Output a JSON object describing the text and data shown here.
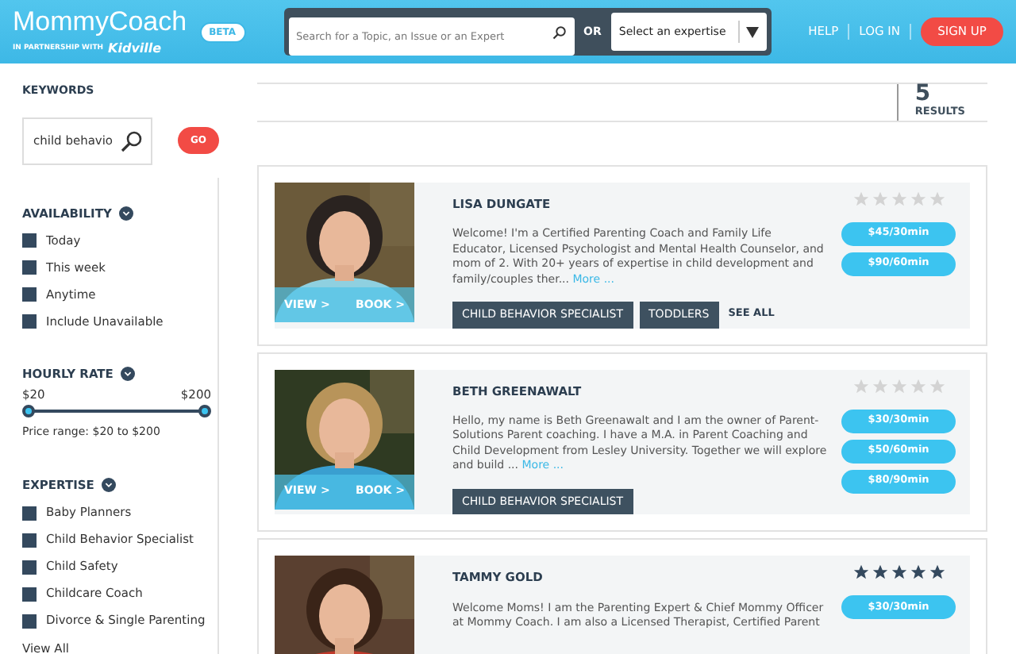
{
  "header": {
    "logo": "MommyCoach",
    "partner_prefix": "IN PARTNERSHIP WITH",
    "partner": "Kidville",
    "badge": "BETA",
    "search": {
      "placeholder": "Search for a Topic, an Issue or an Expert"
    },
    "or": "OR",
    "expertise_select": "Select an expertise",
    "links": [
      "HELP",
      "LOG IN"
    ],
    "signup": "SIGN UP"
  },
  "sidebar": {
    "keywords_label": "KEYWORDS",
    "keyword": "child behavio",
    "go": "GO",
    "availability": {
      "title": "AVAILABILITY",
      "items": [
        {
          "label": "Today",
          "checked": false
        },
        {
          "label": "This week",
          "checked": false
        },
        {
          "label": "Anytime",
          "checked": false
        },
        {
          "label": "Include Unavailable",
          "checked": false
        }
      ]
    },
    "rate": {
      "title": "HOURLY RATE",
      "min": "$20",
      "max": "$200",
      "thumbs": [
        {
          "level": 0
        },
        {
          "level": 1
        }
      ],
      "summary": "Price range: $20 to $200"
    },
    "expertise": {
      "title": "EXPERTISE",
      "items": [
        {
          "label": "Baby Planners",
          "checked": false
        },
        {
          "label": "Child Behavior Specialist",
          "checked": false
        },
        {
          "label": "Child Safety",
          "checked": false
        },
        {
          "label": "Childcare Coach",
          "checked": false
        },
        {
          "label": "Divorce & Single Parenting",
          "checked": false
        }
      ],
      "view_all": "View All"
    }
  },
  "results": {
    "count": "5",
    "label": "RESULTS"
  },
  "experts": [
    {
      "name": "LISA DUNGATE",
      "stars": 0,
      "bio": "Welcome! I'm a Certified Parenting Coach and Family Life Educator, Licensed Psychologist and Mental Health Counselor, and mom of 2. With 20+ years of expertise in child development and family/couples ther...",
      "more": "More ...",
      "prices": [
        "$45/30min",
        "$90/60min"
      ],
      "tags": [
        "CHILD BEHAVIOR SPECIALIST",
        "TODDLERS"
      ],
      "see_all": "SEE ALL",
      "view": "VIEW >",
      "book": "BOOK >"
    },
    {
      "name": "BETH GREENAWALT",
      "stars": 0,
      "bio": "Hello, my name is Beth Greenawalt and I am the owner of Parent-Solutions Parent coaching. I have a M.A. in Parent Coaching and Child Development from Lesley University. Together we will explore and build ...",
      "more": "More ...",
      "prices": [
        "$30/30min",
        "$50/60min",
        "$80/90min"
      ],
      "tags": [
        "CHILD BEHAVIOR SPECIALIST"
      ],
      "view": "VIEW >",
      "book": "BOOK >"
    },
    {
      "name": "TAMMY GOLD",
      "stars": 5,
      "bio": "Welcome Moms! I am the Parenting Expert & Chief Mommy Officer at Mommy Coach. I am also a Licensed Therapist, Certified Parent",
      "prices": [
        "$30/30min"
      ]
    }
  ]
}
